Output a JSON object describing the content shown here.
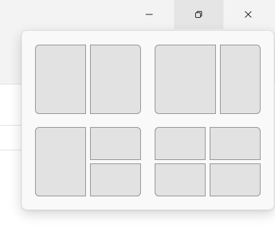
{
  "window": {
    "caption_buttons": [
      {
        "name": "minimize",
        "icon": "minimize-icon"
      },
      {
        "name": "restore",
        "icon": "restore-icon",
        "state": "hovered"
      },
      {
        "name": "close",
        "icon": "close-icon"
      }
    ]
  },
  "snap_layouts": {
    "layouts": [
      {
        "name": "two-equal-columns",
        "zones": 2
      },
      {
        "name": "wide-left-narrow-right",
        "zones": 2
      },
      {
        "name": "left-column-right-stacked",
        "zones": 3
      },
      {
        "name": "four-quadrants",
        "zones": 4
      }
    ]
  },
  "colors": {
    "zone_fill": "#e2e2e2",
    "zone_border": "#8f8f8f",
    "flyout_bg": "#f9f9f9",
    "hover_bg": "#e5e5e5"
  }
}
